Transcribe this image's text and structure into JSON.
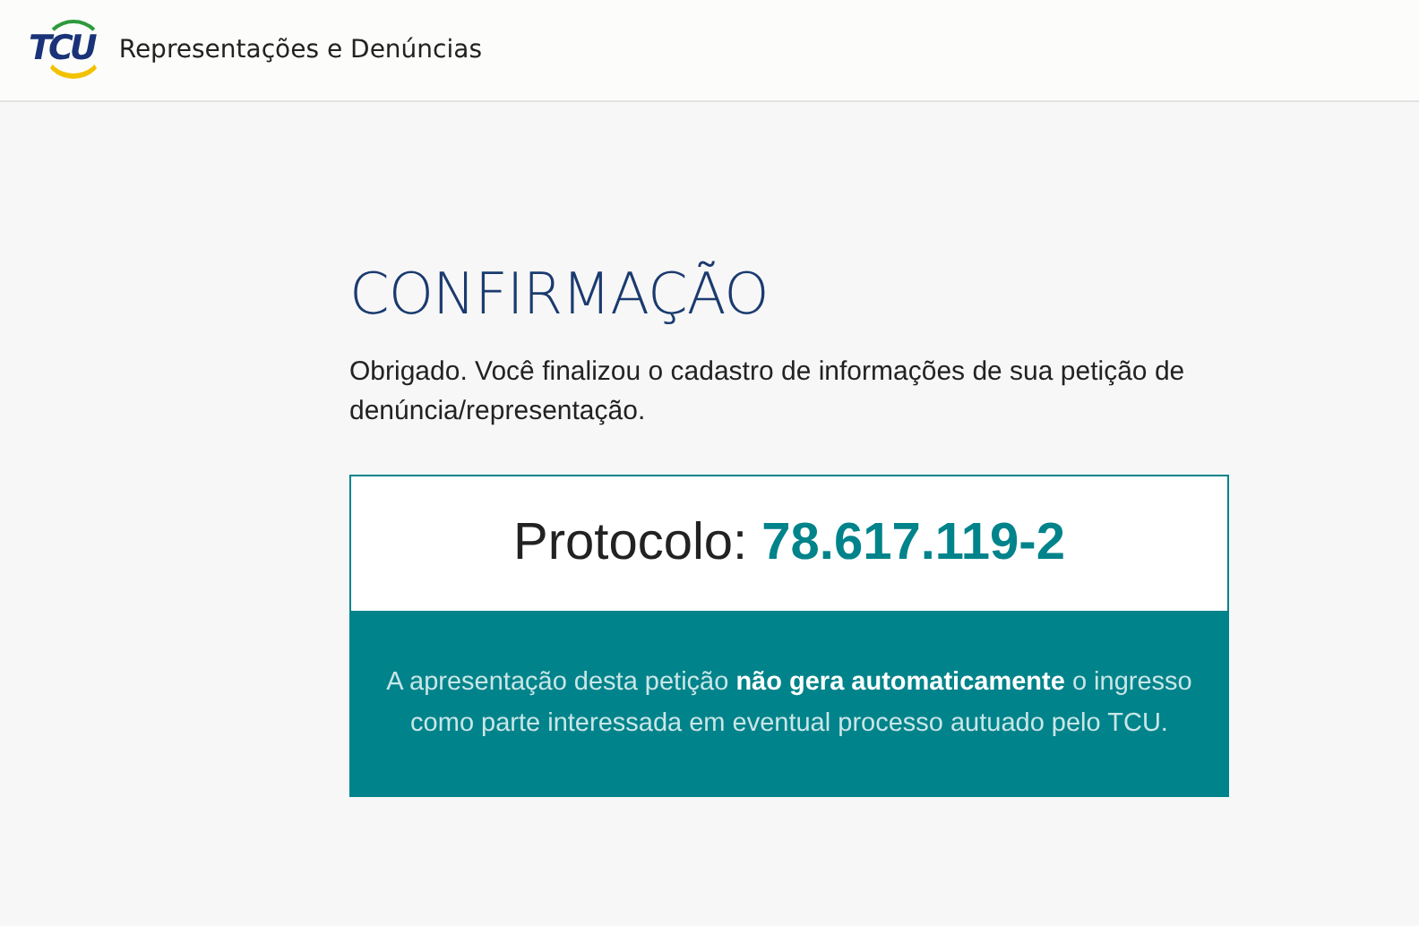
{
  "header": {
    "logo": "TCU",
    "title": "Representações e Denúncias"
  },
  "confirmation": {
    "heading": "CONFIRMAÇÃO",
    "message": "Obrigado. Você finalizou o cadastro de informações de sua petição de denúncia/representação.",
    "protocol_label": "Protocolo:",
    "protocol_number": "78.617.119-2",
    "notice": "A apresentação desta petição **não gera automaticamente** o ingresso como parte interessada em eventual processo autuado pelo TCU."
  }
}
